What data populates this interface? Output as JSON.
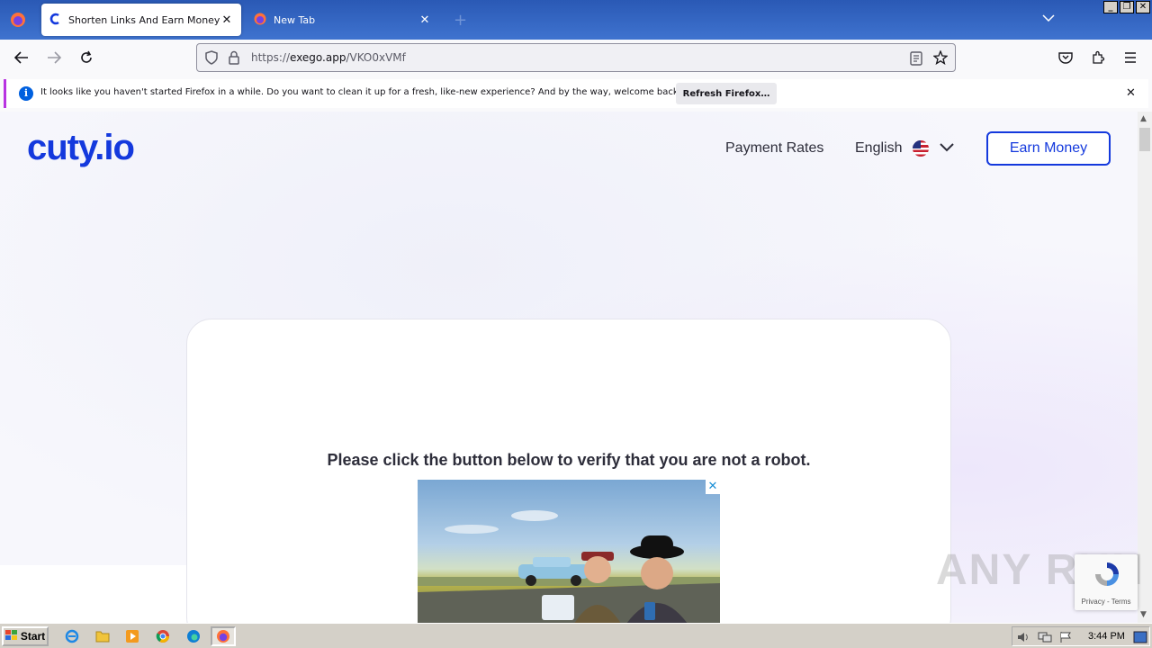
{
  "tabs": [
    {
      "title": "Shorten Links And Earn Money | cu",
      "active": true,
      "icon": "cuty-favicon-icon"
    },
    {
      "title": "New Tab",
      "active": false,
      "icon": "firefox-icon"
    }
  ],
  "window_controls": {
    "minimize": "_",
    "restore": "❐",
    "close": "✕"
  },
  "url": {
    "scheme": "https://",
    "host": "exego.app",
    "path": "/VKO0xVMf"
  },
  "notification": {
    "message": "It looks like you haven't started Firefox in a while. Do you want to clean it up for a fresh, like-new experience? And by the way, welcome back!",
    "button": "Refresh Firefox…"
  },
  "site": {
    "logo": "cuty.io",
    "nav": {
      "payment_rates": "Payment Rates",
      "language": "English",
      "earn_money": "Earn Money"
    },
    "verify_text": "Please click the button below to verify that you are not a robot.",
    "recaptcha_links": "Privacy - Terms"
  },
  "watermark": "ANY RUN",
  "taskbar": {
    "start": "Start",
    "clock": "3:44 PM"
  },
  "colors": {
    "brand": "#1439dd",
    "firefox_accent": "#0060df"
  }
}
